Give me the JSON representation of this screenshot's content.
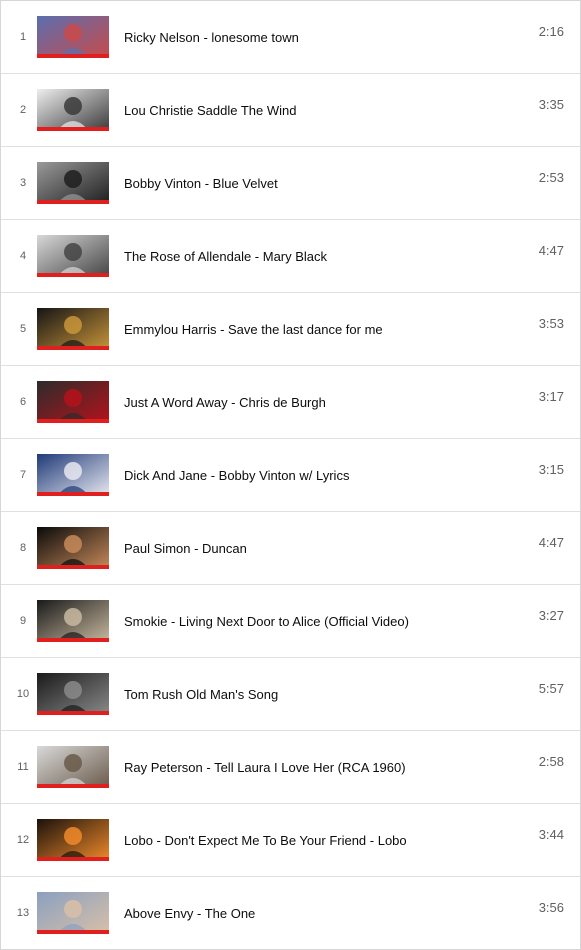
{
  "playlist": {
    "items": [
      {
        "index": "1",
        "title": "Ricky Nelson - lonesome town",
        "duration": "2:16",
        "thumb_icon": "portrait-thumbnail",
        "colors": [
          "#5a6fb0",
          "#c94a4a"
        ]
      },
      {
        "index": "2",
        "title": "Lou Christie Saddle The Wind",
        "duration": "3:35",
        "thumb_icon": "portrait-thumbnail",
        "colors": [
          "#eeeeee",
          "#3a3a3a"
        ]
      },
      {
        "index": "3",
        "title": "Bobby Vinton - Blue Velvet",
        "duration": "2:53",
        "thumb_icon": "portrait-thumbnail",
        "colors": [
          "#9a9a9a",
          "#1e1e1e"
        ]
      },
      {
        "index": "4",
        "title": "The Rose of Allendale - Mary Black",
        "duration": "4:47",
        "thumb_icon": "album-cover-thumbnail",
        "colors": [
          "#d8d8d8",
          "#444444"
        ]
      },
      {
        "index": "5",
        "title": "Emmylou Harris - Save the last dance for me",
        "duration": "3:53",
        "thumb_icon": "portrait-thumbnail",
        "colors": [
          "#151515",
          "#c9953a"
        ]
      },
      {
        "index": "6",
        "title": "Just A Word Away - Chris de Burgh",
        "duration": "3:17",
        "thumb_icon": "rose-thumbnail",
        "colors": [
          "#2c2c2c",
          "#b5121b"
        ]
      },
      {
        "index": "7",
        "title": "Dick And Jane - Bobby Vinton w/ Lyrics",
        "duration": "3:15",
        "thumb_icon": "sunset-thumbnail",
        "colors": [
          "#1f3a78",
          "#e8e8f0"
        ]
      },
      {
        "index": "8",
        "title": "Paul Simon - Duncan",
        "duration": "4:47",
        "thumb_icon": "portrait-thumbnail",
        "colors": [
          "#0a0a0a",
          "#c78a5a"
        ]
      },
      {
        "index": "9",
        "title": "Smokie - Living Next Door to Alice (Official Video)",
        "duration": "3:27",
        "thumb_icon": "portrait-thumbnail",
        "colors": [
          "#1a1a1a",
          "#c8b9a0"
        ]
      },
      {
        "index": "10",
        "title": "Tom Rush Old Man's Song",
        "duration": "5:57",
        "thumb_icon": "portrait-thumbnail",
        "colors": [
          "#1a1a1a",
          "#8a8a8a"
        ]
      },
      {
        "index": "11",
        "title": "Ray Peterson - Tell Laura I Love Her (RCA 1960)",
        "duration": "2:58",
        "thumb_icon": "portrait-thumbnail",
        "colors": [
          "#d9d9d9",
          "#6a5a4a"
        ]
      },
      {
        "index": "12",
        "title": "Lobo - Don't Expect Me To Be Your Friend - Lobo",
        "duration": "3:44",
        "thumb_icon": "sunset-thumbnail",
        "colors": [
          "#1a120c",
          "#f08a2a"
        ]
      },
      {
        "index": "13",
        "title": "Above Envy - The One",
        "duration": "3:56",
        "thumb_icon": "portrait-thumbnail",
        "colors": [
          "#8aa0c0",
          "#d8c0a8"
        ]
      }
    ],
    "progress_bar_color": "#e01f1f"
  }
}
